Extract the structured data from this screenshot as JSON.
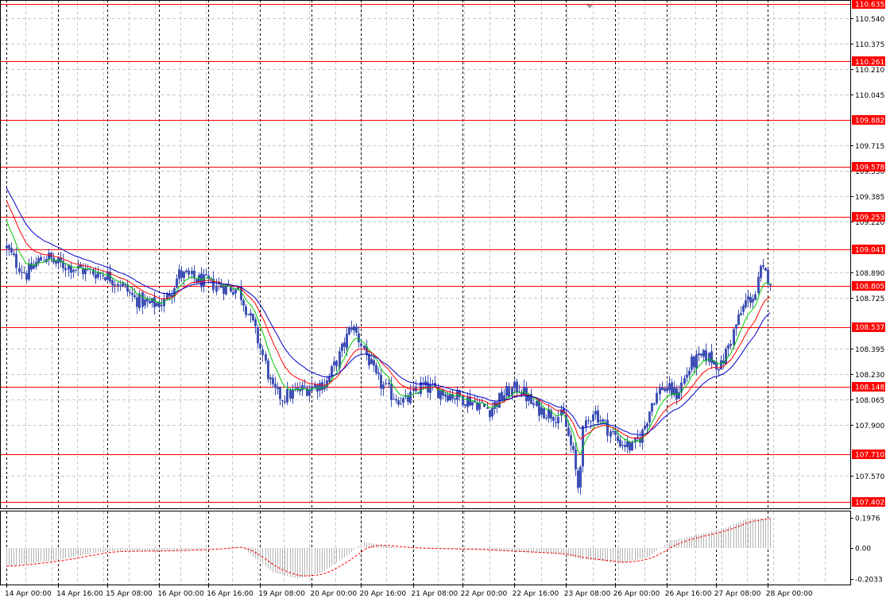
{
  "colors": {
    "background": "#ffffff",
    "grid": "#c8c8c8",
    "session_separator": "#000000",
    "level_line": "#ff0000",
    "level_label_bg": "#ff0000",
    "level_label_text": "#ffffff",
    "candle_body": "#3f51b5",
    "ma_fast": "#00c800",
    "ma_mid": "#ff0000",
    "ma_slow": "#0000c8",
    "oscillator_hist": "#b4b4b4",
    "oscillator_signal": "#ff0000"
  },
  "chart_data": [
    {
      "type": "candlestick",
      "grid": true,
      "legend": "none",
      "ylim": [
        107.36,
        110.66
      ],
      "y_ticks": [
        "110.540",
        "110.375",
        "110.210",
        "110.045",
        "109.715",
        "109.550",
        "109.385",
        "109.220",
        "108.890",
        "108.725",
        "108.395",
        "108.230",
        "108.065",
        "107.900",
        "107.570"
      ],
      "x_ticks": [
        "14 Apr 00:00",
        "14 Apr 16:00",
        "15 Apr 08:00",
        "16 Apr 00:00",
        "16 Apr 16:00",
        "19 Apr 08:00",
        "20 Apr 00:00",
        "20 Apr 16:00",
        "21 Apr 08:00",
        "22 Apr 00:00",
        "22 Apr 16:00",
        "23 Apr 08:00",
        "26 Apr 00:00",
        "26 Apr 16:00",
        "27 Apr 08:00",
        "28 Apr 00:00"
      ],
      "levels": [
        "110.635",
        "110.261",
        "109.882",
        "109.578",
        "109.253",
        "109.041",
        "108.805",
        "108.537",
        "108.148",
        "107.710",
        "107.402"
      ],
      "price_waypoints": [
        [
          0,
          109.05
        ],
        [
          4,
          108.95
        ],
        [
          8,
          108.88
        ],
        [
          12,
          108.95
        ],
        [
          16,
          109.0
        ],
        [
          20,
          108.95
        ],
        [
          26,
          108.93
        ],
        [
          32,
          108.9
        ],
        [
          40,
          108.88
        ],
        [
          46,
          108.82
        ],
        [
          52,
          108.72
        ],
        [
          58,
          108.68
        ],
        [
          64,
          108.7
        ],
        [
          70,
          108.88
        ],
        [
          76,
          108.85
        ],
        [
          82,
          108.82
        ],
        [
          88,
          108.8
        ],
        [
          94,
          108.78
        ],
        [
          100,
          108.55
        ],
        [
          104,
          108.35
        ],
        [
          108,
          108.12
        ],
        [
          112,
          108.08
        ],
        [
          118,
          108.12
        ],
        [
          124,
          108.15
        ],
        [
          130,
          108.18
        ],
        [
          135,
          108.35
        ],
        [
          140,
          108.55
        ],
        [
          145,
          108.4
        ],
        [
          150,
          108.2
        ],
        [
          156,
          108.1
        ],
        [
          162,
          108.05
        ],
        [
          168,
          108.15
        ],
        [
          176,
          108.12
        ],
        [
          184,
          108.08
        ],
        [
          190,
          108.05
        ],
        [
          196,
          108.0
        ],
        [
          202,
          108.1
        ],
        [
          208,
          108.15
        ],
        [
          214,
          108.02
        ],
        [
          220,
          107.98
        ],
        [
          226,
          107.95
        ],
        [
          230,
          107.7
        ],
        [
          232,
          107.5
        ],
        [
          234,
          107.85
        ],
        [
          238,
          108.0
        ],
        [
          242,
          107.92
        ],
        [
          248,
          107.8
        ],
        [
          254,
          107.75
        ],
        [
          258,
          107.85
        ],
        [
          262,
          108.05
        ],
        [
          266,
          108.15
        ],
        [
          272,
          108.1
        ],
        [
          278,
          108.3
        ],
        [
          284,
          108.35
        ],
        [
          290,
          108.28
        ],
        [
          296,
          108.55
        ],
        [
          300,
          108.7
        ],
        [
          304,
          108.75
        ],
        [
          306,
          108.9
        ],
        [
          310,
          108.85
        ]
      ],
      "ma_fast_period": 8,
      "ma_mid_period": 16,
      "ma_slow_period": 26,
      "ma_seed_values": {
        "ma_fast": 109.28,
        "ma_mid": 109.4,
        "ma_slow": 109.47
      }
    },
    {
      "type": "oscillator",
      "grid": true,
      "ylim": [
        -0.24,
        0.24
      ],
      "y_ticks": [
        "0.1976",
        "0.00",
        "-0.2033"
      ],
      "histogram_waypoints": [
        [
          0,
          -0.12
        ],
        [
          20,
          -0.08
        ],
        [
          40,
          -0.02
        ],
        [
          60,
          -0.02
        ],
        [
          80,
          -0.01
        ],
        [
          95,
          0.01
        ],
        [
          108,
          -0.16
        ],
        [
          118,
          -0.2
        ],
        [
          128,
          -0.16
        ],
        [
          138,
          -0.05
        ],
        [
          145,
          0.04
        ],
        [
          160,
          0.0
        ],
        [
          190,
          -0.01
        ],
        [
          225,
          -0.04
        ],
        [
          232,
          -0.07
        ],
        [
          250,
          -0.1
        ],
        [
          260,
          -0.06
        ],
        [
          270,
          0.05
        ],
        [
          290,
          0.12
        ],
        [
          300,
          0.19
        ],
        [
          310,
          0.2
        ]
      ]
    }
  ]
}
